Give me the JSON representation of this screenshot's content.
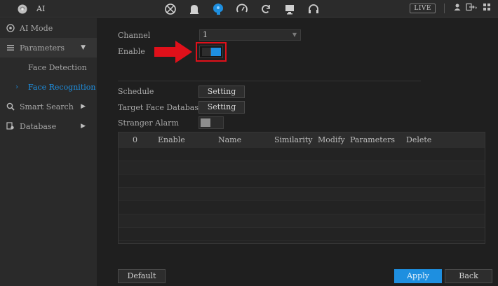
{
  "app": {
    "title": "AI",
    "icon": "ai-brain-icon"
  },
  "topbar": {
    "icons": [
      "camera-lens-icon",
      "alarm-bell-icon",
      "ai-brain-icon",
      "speedometer-icon",
      "refresh-icon",
      "monitor-icon",
      "headset-icon"
    ],
    "live_label": "LIVE",
    "right_icons": [
      "user-icon",
      "logout-icon",
      "grid-icon"
    ]
  },
  "sidebar": {
    "items": [
      {
        "label": "AI Mode",
        "icon": "ai-mode-icon"
      },
      {
        "label": "Parameters",
        "icon": "list-icon",
        "expanded": true
      },
      {
        "label": "Face Detection",
        "sub": true
      },
      {
        "label": "Face Recognition",
        "sub": true,
        "selected": true
      },
      {
        "label": "Smart Search",
        "icon": "search-icon"
      },
      {
        "label": "Database",
        "icon": "database-icon"
      }
    ]
  },
  "form": {
    "channel_label": "Channel",
    "channel_value": "1",
    "enable_label": "Enable",
    "enable_on": true,
    "schedule_label": "Schedule",
    "schedule_button": "Setting",
    "target_db_label": "Target Face Database",
    "target_db_button": "Setting",
    "stranger_label": "Stranger Alarm",
    "stranger_on": false
  },
  "table": {
    "columns": [
      "0",
      "Enable",
      "Name",
      "Similarity",
      "Modify",
      "Parameters",
      "Delete"
    ],
    "rows": []
  },
  "footer": {
    "default_label": "Default",
    "apply_label": "Apply",
    "back_label": "Back"
  },
  "colors": {
    "accent": "#1e8fe0",
    "highlight": "#e0101a"
  }
}
